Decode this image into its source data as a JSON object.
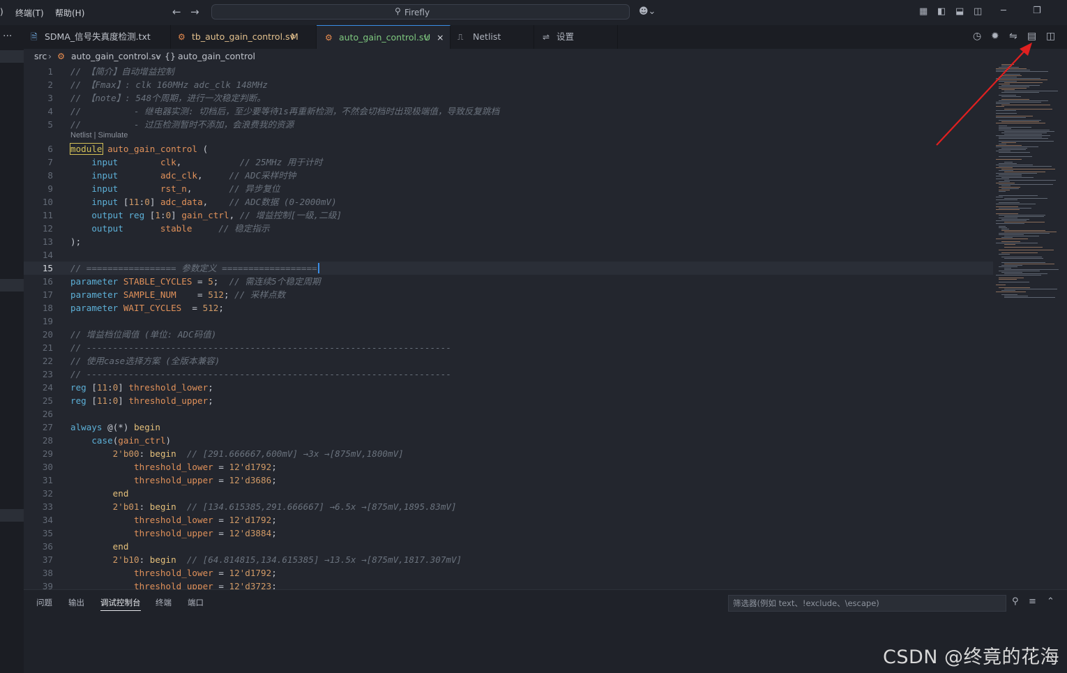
{
  "menu": {
    "partial": ")",
    "terminal": "终端(T)",
    "help": "帮助(H)"
  },
  "command_center": {
    "text": "Firefly"
  },
  "tabs": [
    {
      "label": "SDMA_信号失真度检测.txt",
      "badge": ""
    },
    {
      "label": "tb_auto_gain_control.sv",
      "badge": "M"
    },
    {
      "label": "auto_gain_control.sv",
      "badge": "U",
      "close": "×"
    },
    {
      "label": "Netlist",
      "badge": ""
    },
    {
      "label": "设置",
      "badge": ""
    }
  ],
  "breadcrumb": {
    "folder": "src",
    "file": "auto_gain_control.sv",
    "symbol": "auto_gain_control"
  },
  "codelens": "Netlist | Simulate",
  "current_line": "15",
  "code_lines": [
    {
      "n": "1",
      "t": "// 【简介】自动增益控制"
    },
    {
      "n": "2",
      "t": "// 【Fmax】: clk 160MHz adc_clk 148MHz"
    },
    {
      "n": "3",
      "t": "// 【note】: 548个周期，进行一次稳定判断。"
    },
    {
      "n": "4",
      "t": "//          - 继电器实测: 切档后，至少要等待1s再重新检测，不然会切档时出现极端值，导致反复跳档"
    },
    {
      "n": "5",
      "t": "//          - 过压检测暂时不添加，会浪费我的资源"
    },
    {
      "n": "6",
      "t": "module auto_gain_control ("
    },
    {
      "n": "7",
      "t": "    input        clk,           // 25MHz 用于计时"
    },
    {
      "n": "8",
      "t": "    input        adc_clk,     // ADC采样时钟"
    },
    {
      "n": "9",
      "t": "    input        rst_n,       // 异步复位"
    },
    {
      "n": "10",
      "t": "    input [11:0] adc_data,    // ADC数据 (0-2000mV)"
    },
    {
      "n": "11",
      "t": "    output reg [1:0] gain_ctrl, // 增益控制[一级,二级]"
    },
    {
      "n": "12",
      "t": "    output       stable     // 稳定指示"
    },
    {
      "n": "13",
      "t": ");"
    },
    {
      "n": "14",
      "t": ""
    },
    {
      "n": "15",
      "t": "// ================= 参数定义 =================="
    },
    {
      "n": "16",
      "t": "parameter STABLE_CYCLES = 5;  // 需连续5个稳定周期"
    },
    {
      "n": "17",
      "t": "parameter SAMPLE_NUM    = 512; // 采样点数"
    },
    {
      "n": "18",
      "t": "parameter WAIT_CYCLES  = 512;"
    },
    {
      "n": "19",
      "t": ""
    },
    {
      "n": "20",
      "t": "// 增益档位阈值 (单位: ADC码值)"
    },
    {
      "n": "21",
      "t": "// ---------------------------------------------------------------------"
    },
    {
      "n": "22",
      "t": "// 使用case选择方案 (全版本兼容)"
    },
    {
      "n": "23",
      "t": "// ---------------------------------------------------------------------"
    },
    {
      "n": "24",
      "t": "reg [11:0] threshold_lower;"
    },
    {
      "n": "25",
      "t": "reg [11:0] threshold_upper;"
    },
    {
      "n": "26",
      "t": ""
    },
    {
      "n": "27",
      "t": "always @(*) begin"
    },
    {
      "n": "28",
      "t": "    case(gain_ctrl)"
    },
    {
      "n": "29",
      "t": "        2'b00: begin  // [291.666667,600mV] →3x →[875mV,1800mV]"
    },
    {
      "n": "30",
      "t": "            threshold_lower = 12'd1792;"
    },
    {
      "n": "31",
      "t": "            threshold_upper = 12'd3686;"
    },
    {
      "n": "32",
      "t": "        end"
    },
    {
      "n": "33",
      "t": "        2'b01: begin  // [134.615385,291.666667] →6.5x →[875mV,1895.83mV]"
    },
    {
      "n": "34",
      "t": "            threshold_lower = 12'd1792;"
    },
    {
      "n": "35",
      "t": "            threshold_upper = 12'd3884;"
    },
    {
      "n": "36",
      "t": "        end"
    },
    {
      "n": "37",
      "t": "        2'b10: begin  // [64.814815,134.615385] →13.5x →[875mV,1817.307mV]"
    },
    {
      "n": "38",
      "t": "            threshold_lower = 12'd1792;"
    },
    {
      "n": "39",
      "t": "            threshold_upper = 12'd3723;"
    }
  ],
  "panel": {
    "tabs": [
      "问题",
      "输出",
      "调试控制台",
      "终端",
      "端口"
    ],
    "active": "调试控制台",
    "filter_placeholder": "筛选器(例如 text、!exclude、\\escape)"
  },
  "watermark": "CSDN @终竟的花海",
  "colors": {
    "accent": "#3a8ee6",
    "annotation_arrow": "#e02020"
  }
}
